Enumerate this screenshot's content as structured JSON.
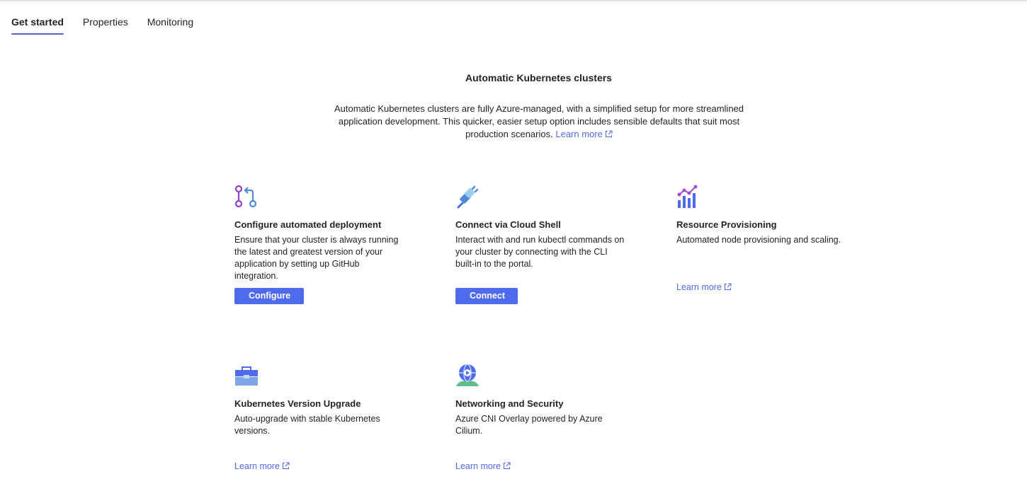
{
  "tabs": [
    {
      "label": "Get started",
      "active": true
    },
    {
      "label": "Properties",
      "active": false
    },
    {
      "label": "Monitoring",
      "active": false
    }
  ],
  "hero": {
    "title": "Automatic Kubernetes clusters",
    "description": "Automatic Kubernetes clusters are fully Azure-managed, with a simplified setup for more streamlined application development. This quicker, easier setup option includes sensible defaults that suit most production scenarios.",
    "learn_more": "Learn more"
  },
  "cards": {
    "deployment": {
      "icon": "git-branch-icon",
      "title": "Configure automated deployment",
      "description": "Ensure that your cluster is always running the latest and greatest version of your application by setting up GitHub integration.",
      "button": "Configure"
    },
    "cloudshell": {
      "icon": "plug-icon",
      "title": "Connect via Cloud Shell",
      "description": "Interact with and run kubectl commands on your cluster by connecting with the CLI built-in to the portal.",
      "button": "Connect"
    },
    "provisioning": {
      "icon": "chart-icon",
      "title": "Resource Provisioning",
      "description": "Automated node provisioning and scaling.",
      "learn_more": "Learn more"
    },
    "upgrade": {
      "icon": "toolbox-icon",
      "title": "Kubernetes Version Upgrade",
      "description": "Auto-upgrade with stable Kubernetes versions.",
      "learn_more": "Learn more"
    },
    "networking": {
      "icon": "globe-icon",
      "title": "Networking and Security",
      "description": "Azure CNI Overlay powered by Azure Cilium.",
      "learn_more": "Learn more"
    }
  },
  "colors": {
    "accent": "#4f6bed",
    "tab_indicator": "#5b5fc7"
  }
}
